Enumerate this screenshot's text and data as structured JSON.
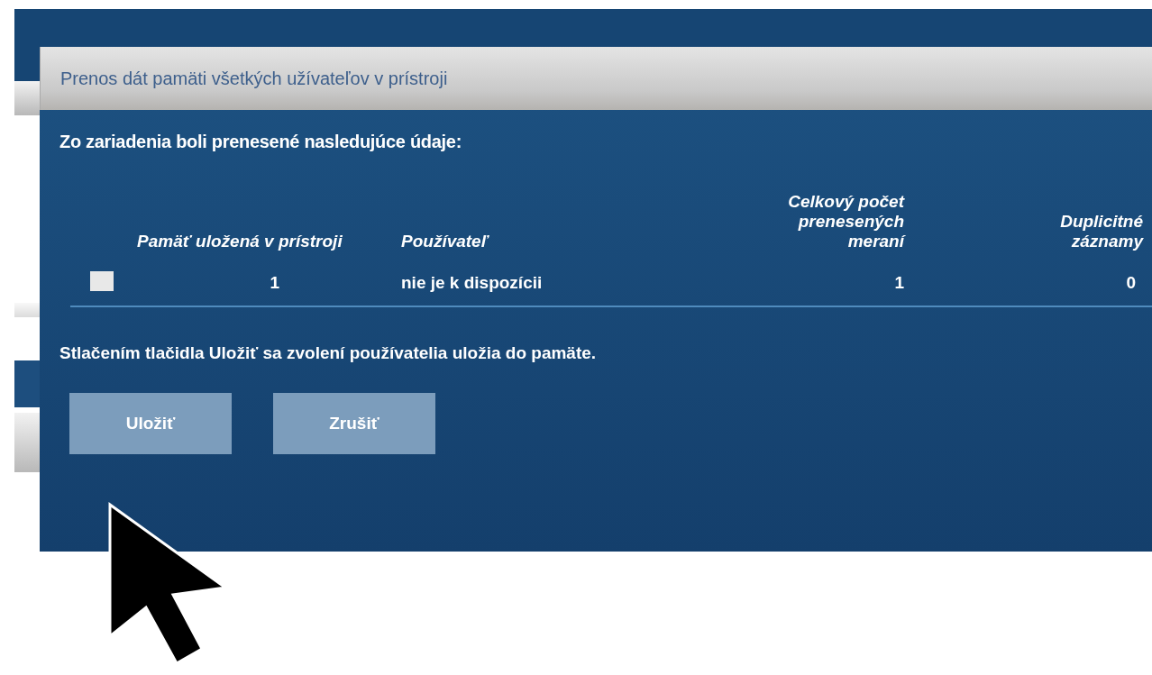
{
  "dialog": {
    "title": "Prenos dát pamäti všetkých užívateľov v prístroji",
    "intro": "Zo zariadenia boli prenesené nasledujúce údaje:",
    "table": {
      "columns": [
        "Pamäť uložená v prístroji",
        "Používateľ",
        "Celkový počet prenesených meraní",
        "Duplicitné záznamy"
      ],
      "rows": [
        {
          "checked": false,
          "cells": [
            "1",
            "nie je k dispozícii",
            "1",
            "0"
          ]
        }
      ]
    },
    "note": "Stlačením tlačidla Uložiť sa zvolení používatelia uložia do pamäte.",
    "buttons": [
      "Uložiť",
      "Zrušiť"
    ]
  }
}
